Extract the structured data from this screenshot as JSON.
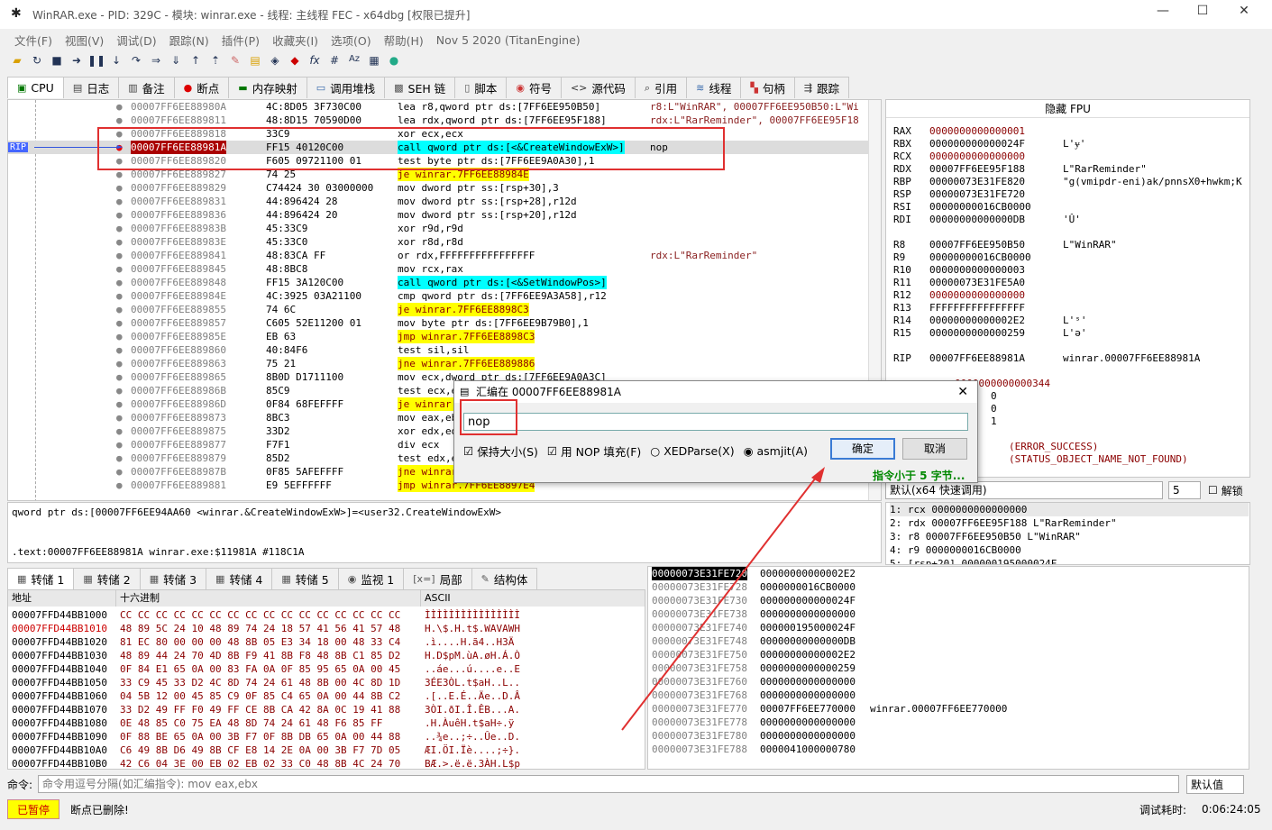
{
  "window": {
    "title": "WinRAR.exe - PID: 329C - 模块: winrar.exe - 线程: 主线程 FEC - x64dbg [权限已提升]"
  },
  "menu": [
    "文件(F)",
    "视图(V)",
    "调试(D)",
    "跟踪(N)",
    "插件(P)",
    "收藏夹(I)",
    "选项(O)",
    "帮助(H)",
    "Nov 5 2020 (TitanEngine)"
  ],
  "tabs": [
    "CPU",
    "日志",
    "备注",
    "断点",
    "内存映射",
    "调用堆栈",
    "SEH 链",
    "脚本",
    "符号",
    "源代码",
    "引用",
    "线程",
    "句柄",
    "跟踪"
  ],
  "disasm": [
    {
      "addr": "00007FF6EE88980A",
      "bytes": "4C:8D05 3F730C00",
      "asm": "lea r8,qword ptr ds:[7FF6EE950B50]",
      "cmt": "r8:L\"WinRAR\", 00007FF6EE950B50:L\"Wi"
    },
    {
      "addr": "00007FF6EE889811",
      "bytes": "48:8D15 70590D00",
      "asm": "lea rdx,qword ptr ds:[7FF6EE95F188]",
      "cmt": "rdx:L\"RarReminder\", 00007FF6EE95F18"
    },
    {
      "addr": "00007FF6EE889818",
      "bytes": "33C9",
      "asm": "xor ecx,ecx",
      "cmt": ""
    },
    {
      "addr": "00007FF6EE88981A",
      "bytes": "FF15 40120C00",
      "asm": "call qword ptr ds:[<&CreateWindowExW>]",
      "cmt": "nop"
    },
    {
      "addr": "00007FF6EE889820",
      "bytes": "F605 09721100 01",
      "asm": "test byte ptr ds:[7FF6EE9A0A30],1",
      "cmt": ""
    },
    {
      "addr": "00007FF6EE889827",
      "bytes": "74 25",
      "asm": "je winrar.7FF6EE88984E",
      "cmt": ""
    },
    {
      "addr": "00007FF6EE889829",
      "bytes": "C74424 30 03000000",
      "asm": "mov dword ptr ss:[rsp+30],3",
      "cmt": ""
    },
    {
      "addr": "00007FF6EE889831",
      "bytes": "44:896424 28",
      "asm": "mov dword ptr ss:[rsp+28],r12d",
      "cmt": ""
    },
    {
      "addr": "00007FF6EE889836",
      "bytes": "44:896424 20",
      "asm": "mov dword ptr ss:[rsp+20],r12d",
      "cmt": ""
    },
    {
      "addr": "00007FF6EE88983B",
      "bytes": "45:33C9",
      "asm": "xor r9d,r9d",
      "cmt": ""
    },
    {
      "addr": "00007FF6EE88983E",
      "bytes": "45:33C0",
      "asm": "xor r8d,r8d",
      "cmt": ""
    },
    {
      "addr": "00007FF6EE889841",
      "bytes": "48:83CA FF",
      "asm": "or rdx,FFFFFFFFFFFFFFFF",
      "cmt": "rdx:L\"RarReminder\""
    },
    {
      "addr": "00007FF6EE889845",
      "bytes": "48:8BC8",
      "asm": "mov rcx,rax",
      "cmt": ""
    },
    {
      "addr": "00007FF6EE889848",
      "bytes": "FF15 3A120C00",
      "asm": "call qword ptr ds:[<&SetWindowPos>]",
      "cmt": ""
    },
    {
      "addr": "00007FF6EE88984E",
      "bytes": "4C:3925 03A21100",
      "asm": "cmp qword ptr ds:[7FF6EE9A3A58],r12",
      "cmt": ""
    },
    {
      "addr": "00007FF6EE889855",
      "bytes": "74 6C",
      "asm": "je winrar.7FF6EE8898C3",
      "cmt": ""
    },
    {
      "addr": "00007FF6EE889857",
      "bytes": "C605 52E11200 01",
      "asm": "mov byte ptr ds:[7FF6EE9B79B0],1",
      "cmt": ""
    },
    {
      "addr": "00007FF6EE88985E",
      "bytes": "EB 63",
      "asm": "jmp winrar.7FF6EE8898C3",
      "cmt": ""
    },
    {
      "addr": "00007FF6EE889860",
      "bytes": "40:84F6",
      "asm": "test sil,sil",
      "cmt": ""
    },
    {
      "addr": "00007FF6EE889863",
      "bytes": "75 21",
      "asm": "jne winrar.7FF6EE889886",
      "cmt": ""
    },
    {
      "addr": "00007FF6EE889865",
      "bytes": "8B0D D1711100",
      "asm": "mov ecx,dword ptr ds:[7FF6EE9A0A3C]",
      "cmt": ""
    },
    {
      "addr": "00007FF6EE88986B",
      "bytes": "85C9",
      "asm": "test ecx,ecx",
      "cmt": ""
    },
    {
      "addr": "00007FF6EE88986D",
      "bytes": "0F84 68FEFFFF",
      "asm": "je winrar.7FF6EE8896DB",
      "cmt": ""
    },
    {
      "addr": "00007FF6EE889873",
      "bytes": "8BC3",
      "asm": "mov eax,ebx",
      "cmt": ""
    },
    {
      "addr": "00007FF6EE889875",
      "bytes": "33D2",
      "asm": "xor edx,edx",
      "cmt": ""
    },
    {
      "addr": "00007FF6EE889877",
      "bytes": "F7F1",
      "asm": "div ecx",
      "cmt": ""
    },
    {
      "addr": "00007FF6EE889879",
      "bytes": "85D2",
      "asm": "test edx,edx",
      "cmt": ""
    },
    {
      "addr": "00007FF6EE88987B",
      "bytes": "0F85 5AFEFFFF",
      "asm": "jne winrar.7FF6EE8896DB",
      "cmt": ""
    },
    {
      "addr": "00007FF6EE889881",
      "bytes": "E9 5EFFFFFF",
      "asm": "jmp winrar.7FF6EE8897E4",
      "cmt": ""
    }
  ],
  "rip_label": "RIP",
  "registers": {
    "header": "隐藏 FPU",
    "rows": [
      {
        "n": "RAX",
        "v": "0000000000000001",
        "c": ""
      },
      {
        "n": "RBX",
        "v": "000000000000024F",
        "c": "L'ɏ'"
      },
      {
        "n": "RCX",
        "v": "0000000000000000",
        "c": ""
      },
      {
        "n": "RDX",
        "v": "00007FF6EE95F188",
        "c": "L\"RarReminder\""
      },
      {
        "n": "RBP",
        "v": "00000073E31FE820",
        "c": "\"g(vmipdr-eni)ak/pnnsX0+hwkm;K"
      },
      {
        "n": "RSP",
        "v": "00000073E31FE720",
        "c": ""
      },
      {
        "n": "RSI",
        "v": "00000000016CB0000",
        "c": ""
      },
      {
        "n": "RDI",
        "v": "00000000000000DB",
        "c": "'Û'"
      },
      {
        "n": "R8",
        "v": "00007FF6EE950B50",
        "c": "L\"WinRAR\""
      },
      {
        "n": "R9",
        "v": "00000000016CB0000",
        "c": ""
      },
      {
        "n": "R10",
        "v": "0000000000000003",
        "c": ""
      },
      {
        "n": "R11",
        "v": "00000073E31FE5A0",
        "c": ""
      },
      {
        "n": "R12",
        "v": "0000000000000000",
        "c": ""
      },
      {
        "n": "R13",
        "v": "FFFFFFFFFFFFFFFF",
        "c": ""
      },
      {
        "n": "R14",
        "v": "00000000000002E2",
        "c": "L'ˢ'"
      },
      {
        "n": "R15",
        "v": "0000000000000259",
        "c": "L'ə'"
      },
      {
        "n": "RIP",
        "v": "00007FF6EE88981A",
        "c": "winrar.00007FF6EE88981A"
      }
    ],
    "extra": [
      {
        "v": "0000000000000344",
        "c": ""
      },
      {
        "v": "0",
        "c": ""
      },
      {
        "v": "0",
        "c": ""
      },
      {
        "v": "1",
        "c": ""
      },
      {
        "v": "00000000",
        "c": "(ERROR_SUCCESS)"
      },
      {
        "v": "C0000034",
        "c": "(STATUS_OBJECT_NAME_NOT_FOUND)"
      }
    ]
  },
  "callconv": {
    "value": "默认(x64 快速调用)",
    "count": "5",
    "unlock": "解锁"
  },
  "stackargs": [
    "1: rcx 0000000000000000",
    "2: rdx 00007FF6EE95F188 L\"RarReminder\"",
    "3: r8 00007FF6EE950B50 L\"WinRAR\"",
    "4: r9 0000000016CB0000",
    "5: [rsp+20] 000000195000024F"
  ],
  "info": {
    "line1": "qword ptr ds:[00007FF6EE94AA60 <winrar.&CreateWindowExW>]=<user32.CreateWindowExW>",
    "line2": ".text:00007FF6EE88981A winrar.exe:$11981A #118C1A"
  },
  "dump_tabs": [
    "转储 1",
    "转储 2",
    "转储 3",
    "转储 4",
    "转储 5",
    "监视 1",
    "局部",
    "结构体"
  ],
  "dump_headers": {
    "addr": "地址",
    "hex": "十六进制",
    "ascii": "ASCII"
  },
  "dump": [
    {
      "a": "00007FFD44BB1000",
      "h": "CC CC CC CC CC CC CC CC CC CC CC CC CC CC CC CC",
      "s": "ÌÌÌÌÌÌÌÌÌÌÌÌÌÌÌÌ"
    },
    {
      "a": "00007FFD44BB1010",
      "h": "48 89 5C 24 10 48 89 74 24 18 57 41 56 41 57 48",
      "s": "H.\\$.H.t$.WAVAWH"
    },
    {
      "a": "00007FFD44BB1020",
      "h": "81 EC 80 00 00 00 48 8B 05 E3 34 18 00 48 33 C4",
      "s": ".ì....H.ã4..H3Ä"
    },
    {
      "a": "00007FFD44BB1030",
      "h": "48 89 44 24 70 4D 8B F9 41 8B F8 48 8B C1 85 D2",
      "s": "H.D$pM.ùA.øH.Á.Ò"
    },
    {
      "a": "00007FFD44BB1040",
      "h": "0F 84 E1 65 0A 00 83 FA 0A 0F 85 95 65 0A 00 45",
      "s": "..áe...ú....e..E"
    },
    {
      "a": "00007FFD44BB1050",
      "h": "33 C9 45 33 D2 4C 8D 74 24 61 48 8B 00 4C 8D 1D",
      "s": "3ÉE3ÒL.t$aH..L.."
    },
    {
      "a": "00007FFD44BB1060",
      "h": "04 5B 12 00 45 85 C9 0F 85 C4 65 0A 00 44 8B C2",
      "s": ".[..E.É..Äe..D.Â"
    },
    {
      "a": "00007FFD44BB1070",
      "h": "33 D2 49 FF F0 49 FF CE 8B CA 42 8A 0C 19 41 88",
      "s": "3ÒI.ðI.Î.ÊB...A."
    },
    {
      "a": "00007FFD44BB1080",
      "h": "0E 48 85 C0 75 EA 48 8D 74 24 61 48 F6 85 FF",
      "s": ".H.ÀuêH.t$aH÷.ÿ"
    },
    {
      "a": "00007FFD44BB1090",
      "h": "0F 88 BE 65 0A 00 3B F7 0F 8B DB 65 0A 00 44 88",
      "s": "..¾e..;÷..Ûe..D."
    },
    {
      "a": "00007FFD44BB10A0",
      "h": "C6 49 8B D6 49 8B CF E8 14 2E 0A 00 3B F7 7D 05",
      "s": "ÆI.ÖI.Ïè....;÷}."
    },
    {
      "a": "00007FFD44BB10B0",
      "h": "42 C6 04 3E 00 EB 02 EB 02 33 C0 48 8B 4C 24 70",
      "s": "BÆ.>.ë.ë.3ÀH.L$p"
    }
  ],
  "stack": [
    {
      "a": "00000073E31FE720",
      "v": "00000000000002E2",
      "c": ""
    },
    {
      "a": "00000073E31FE728",
      "v": "0000000016CB0000",
      "c": ""
    },
    {
      "a": "00000073E31FE730",
      "v": "000000000000024F",
      "c": ""
    },
    {
      "a": "00000073E31FE738",
      "v": "0000000000000000",
      "c": ""
    },
    {
      "a": "00000073E31FE740",
      "v": "000000195000024F",
      "c": ""
    },
    {
      "a": "00000073E31FE748",
      "v": "00000000000000DB",
      "c": ""
    },
    {
      "a": "00000073E31FE750",
      "v": "00000000000002E2",
      "c": ""
    },
    {
      "a": "00000073E31FE758",
      "v": "0000000000000259",
      "c": ""
    },
    {
      "a": "00000073E31FE760",
      "v": "0000000000000000",
      "c": ""
    },
    {
      "a": "00000073E31FE768",
      "v": "0000000000000000",
      "c": ""
    },
    {
      "a": "00000073E31FE770",
      "v": "00007FF6EE770000",
      "c": "winrar.00007FF6EE770000"
    },
    {
      "a": "00000073E31FE778",
      "v": "0000000000000000",
      "c": ""
    },
    {
      "a": "00000073E31FE780",
      "v": "0000000000000000",
      "c": ""
    },
    {
      "a": "00000073E31FE788",
      "v": "0000041000000780",
      "c": ""
    }
  ],
  "cmd": {
    "label": "命令:",
    "placeholder": "命令用逗号分隔(如汇编指令): mov eax,ebx",
    "default": "默认值"
  },
  "status": {
    "paused": "已暂停",
    "msg": "断点已删除!",
    "time_label": "调试耗时:",
    "time": "0:06:24:05"
  },
  "dialog": {
    "title": "汇编在 00007FF6EE88981A",
    "input": "nop",
    "opt1": "保持大小(S)",
    "opt2": "用 NOP 填充(F)",
    "opt3": "XEDParse(X)",
    "opt4": "asmjit(A)",
    "ok": "确定",
    "cancel": "取消",
    "hint": "指令小于 5 字节..."
  },
  "colors": {
    "call": "#00ffff",
    "jump": "#ffff00",
    "red": "#e03030",
    "paused": "#ffff00"
  }
}
